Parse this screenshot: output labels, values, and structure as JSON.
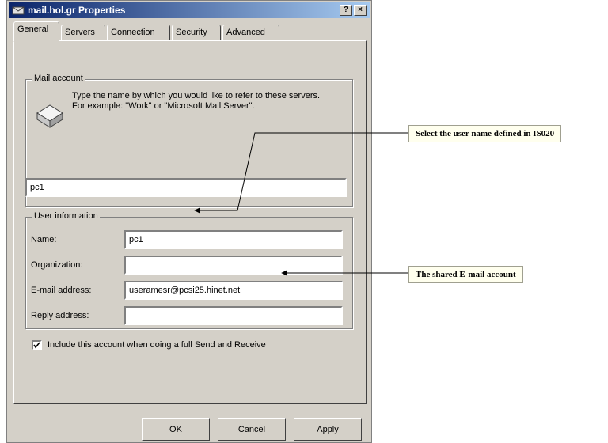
{
  "window": {
    "title": "mail.hol.gr Properties",
    "help_label": "?",
    "close_label": "×"
  },
  "tabs": [
    {
      "label": "General",
      "active": true
    },
    {
      "label": "Servers",
      "active": false
    },
    {
      "label": "Connection",
      "active": false
    },
    {
      "label": "Security",
      "active": false
    },
    {
      "label": "Advanced",
      "active": false
    }
  ],
  "mail_account": {
    "group_label": "Mail account",
    "description": "Type the name by which you would like to refer to these servers.  For example: \"Work\" or \"Microsoft Mail Server\".",
    "value": "pc1"
  },
  "user_info": {
    "group_label": "User information",
    "name_label": "Name:",
    "name_value": "pc1",
    "org_label": "Organization:",
    "org_value": "",
    "email_label": "E-mail address:",
    "email_value": "useramesr@pcsi25.hinet.net",
    "reply_label": "Reply address:",
    "reply_value": ""
  },
  "include_checkbox": {
    "label": "Include this account when doing a full Send and Receive",
    "checked": true
  },
  "buttons": {
    "ok": "OK",
    "cancel": "Cancel",
    "apply": "Apply"
  },
  "callouts": {
    "user_name": "Select the user name defined in IS020",
    "email": "The shared E-mail account"
  }
}
